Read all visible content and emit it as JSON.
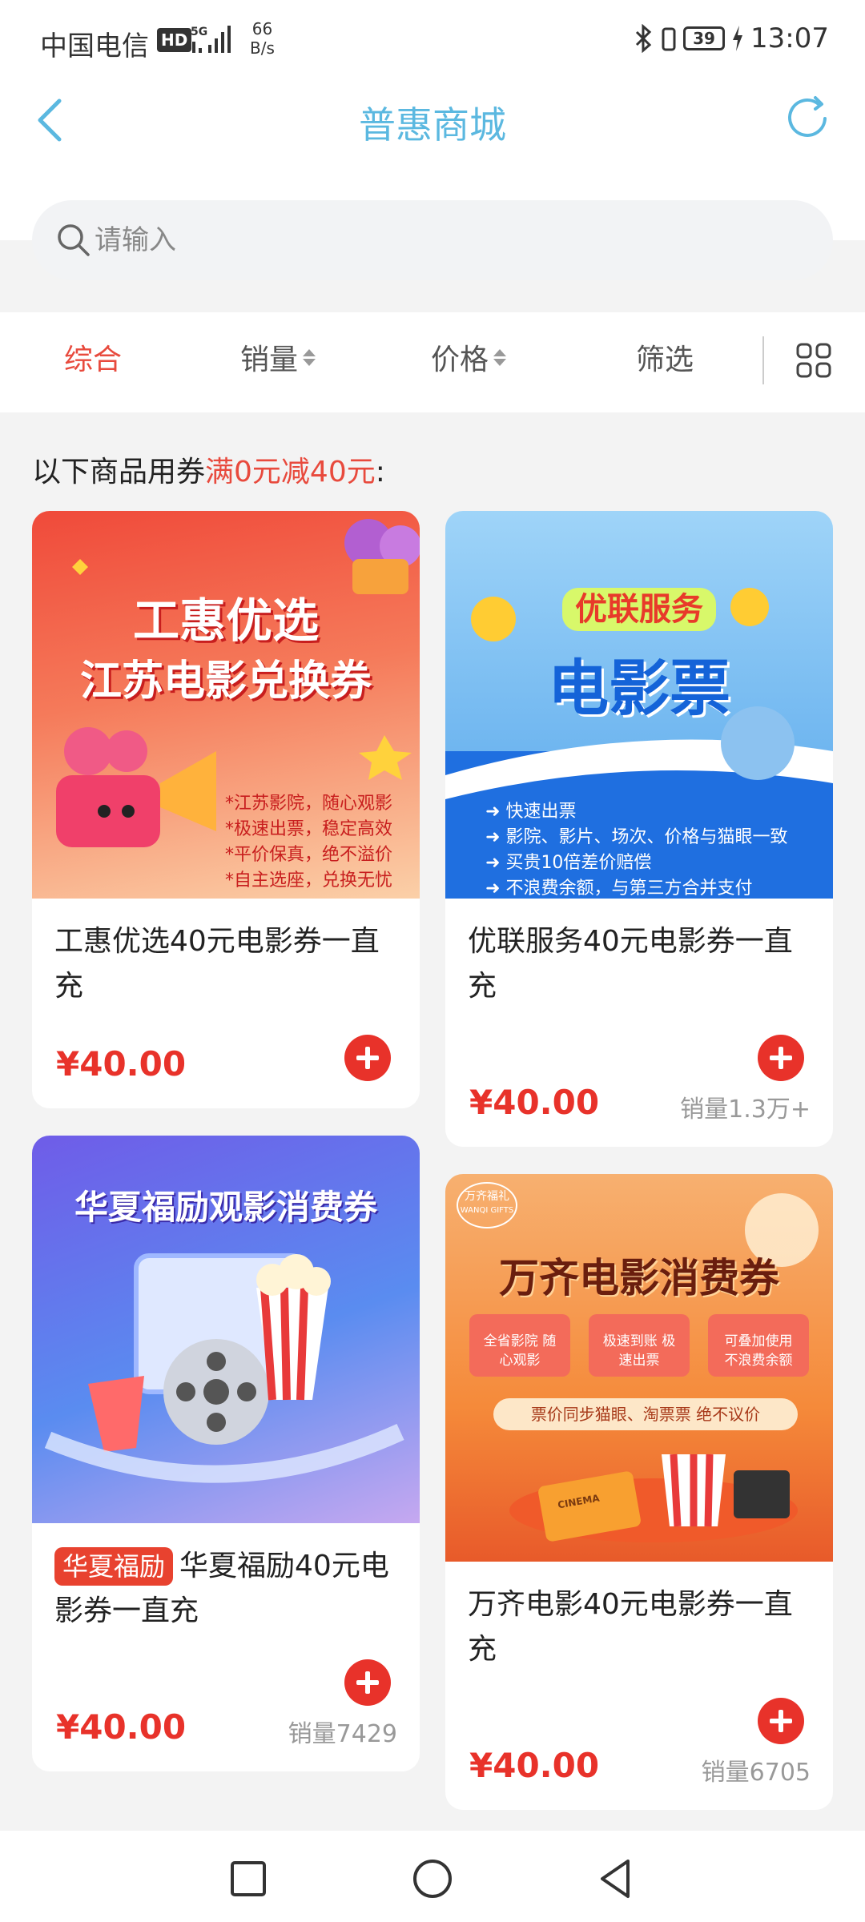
{
  "status_bar": {
    "carrier": "中国电信",
    "hd": "HD",
    "speed_value": "66",
    "speed_unit": "B/s",
    "battery": "39",
    "time": "13:07"
  },
  "header": {
    "title": "普惠商城",
    "accent_color": "#5bb8e0"
  },
  "search": {
    "placeholder": "请输入"
  },
  "sort_tabs": [
    {
      "label": "综合",
      "active": true
    },
    {
      "label": "销量",
      "active": false
    },
    {
      "label": "价格",
      "active": false
    },
    {
      "label": "筛选",
      "active": false
    }
  ],
  "coupon_hint": {
    "prefix": "以下商品用券",
    "highlight": "满0元减40元",
    "suffix": ":"
  },
  "products": [
    {
      "name": "工惠优选40元电影券一直充",
      "price": "¥40.00",
      "sales": "",
      "image": {
        "line1": "工惠优选",
        "line2": "江苏电影兑换券",
        "bullets": [
          "*江苏影院，随心观影",
          "*极速出票，稳定高效",
          "*平价保真，绝不溢价",
          "*自主选座，兑换无忧"
        ]
      }
    },
    {
      "name": "优联服务40元电影券一直充",
      "price": "¥40.00",
      "sales": "销量1.3万+",
      "image": {
        "line1": "优联服务",
        "line2": "电影票",
        "bullets": [
          "快速出票",
          "影院、影片、场次、价格与猫眼一致",
          "买贵10倍差价赔偿",
          "不浪费余额，与第三方合并支付"
        ]
      }
    },
    {
      "tag": "华夏福励",
      "name": "华夏福励40元电影券一直充",
      "price": "¥40.00",
      "sales": "销量7429",
      "image": {
        "line1": "华夏福励观影消费券"
      }
    },
    {
      "name": "万齐电影40元电影券一直充",
      "price": "¥40.00",
      "sales": "销量6705",
      "image": {
        "logo": "万齐福礼",
        "logo_en": "WANQI GIFTS",
        "line1": "万齐电影消费券",
        "boxes": [
          "全省影院 随心观影",
          "极速到账 极速出票",
          "可叠加使用 不浪费余额"
        ],
        "banner": "票价同步猫眼、淘票票 绝不议价",
        "ticket": "CINEMA"
      }
    }
  ],
  "nav_bar": {
    "icons": [
      "square-icon",
      "circle-icon",
      "triangle-back-icon"
    ]
  }
}
